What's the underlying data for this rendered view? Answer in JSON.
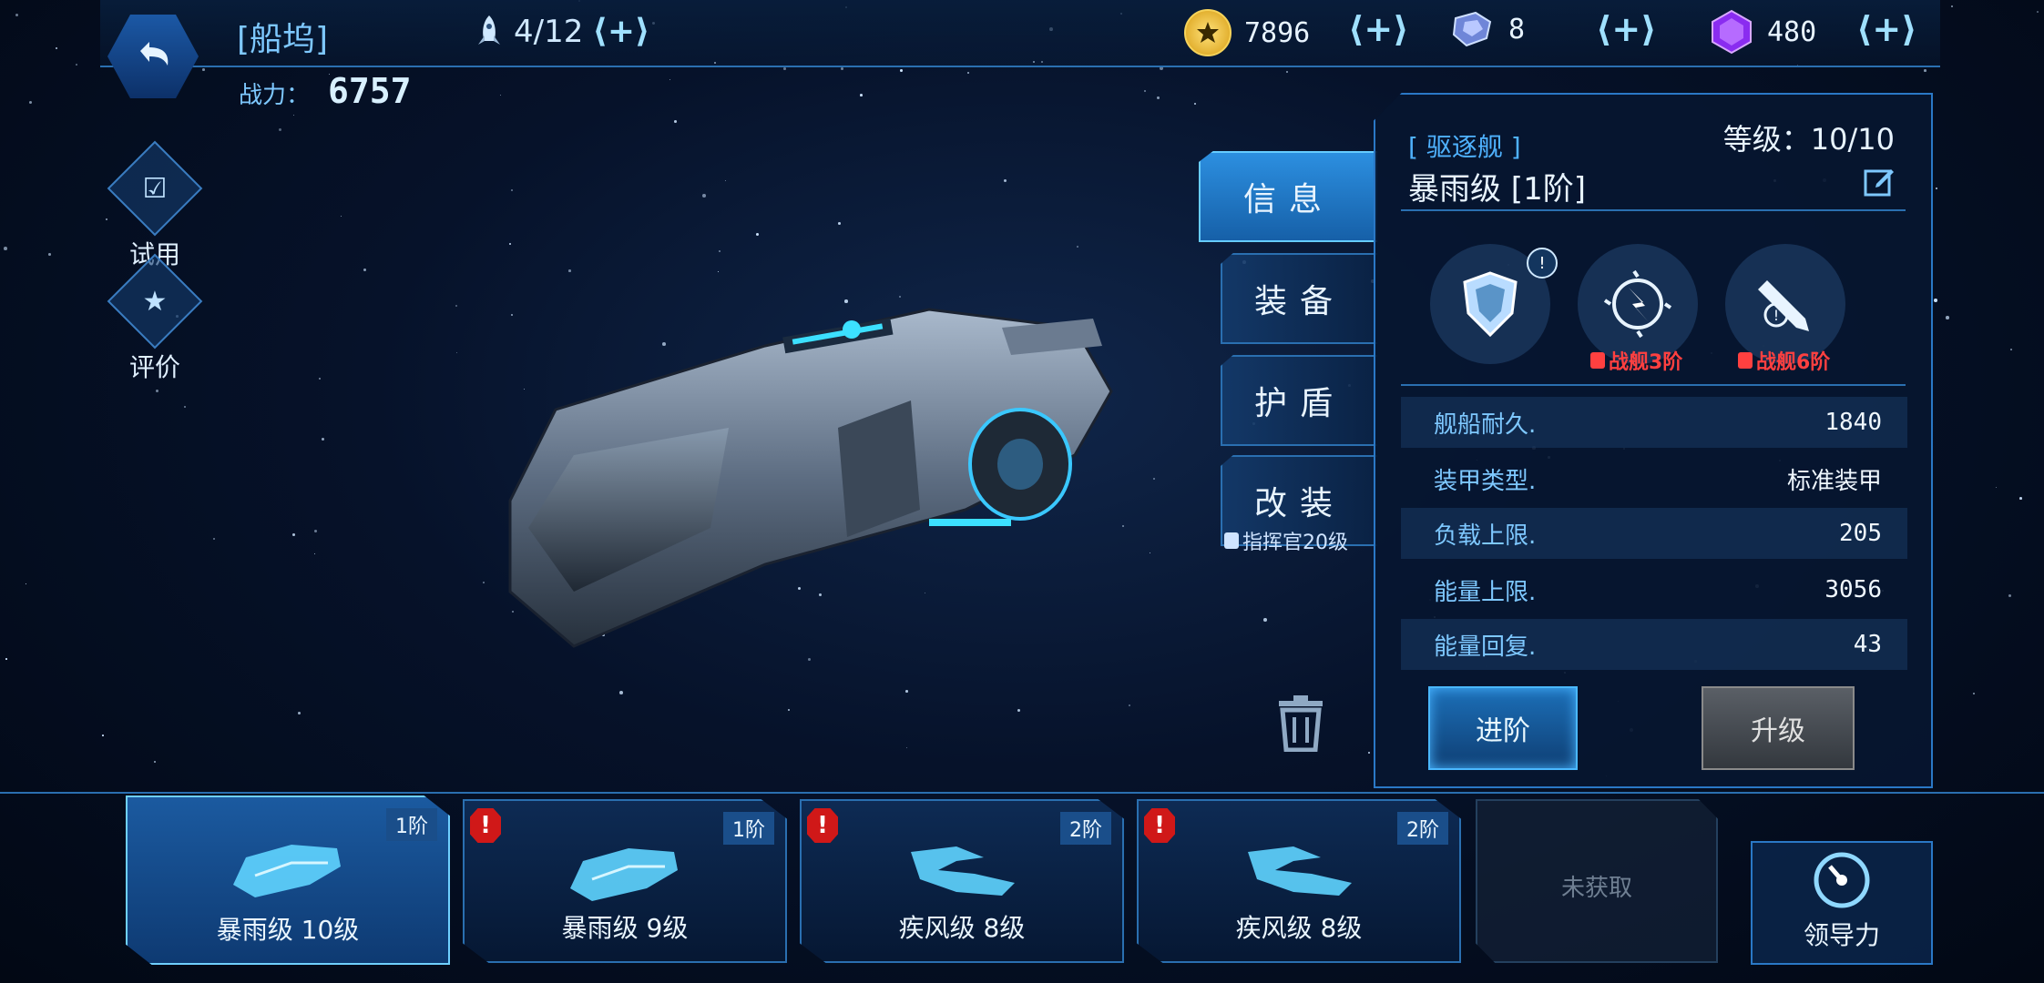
{
  "header": {
    "title": "[船坞]",
    "power_label": "战力：",
    "power_value": "6757",
    "fleet_count": "4/12",
    "fleet_plus": "⟨+⟩"
  },
  "resources": [
    {
      "name": "gold-coin",
      "value": "7896",
      "plus": "⟨+⟩",
      "color": "#f2c02c"
    },
    {
      "name": "crystal",
      "value": "8",
      "plus": "⟨+⟩",
      "color": "#8fa8ff"
    },
    {
      "name": "purple-gem",
      "value": "480",
      "plus": "⟨+⟩",
      "color": "#9c3cff"
    }
  ],
  "side": {
    "trial_label": "试用",
    "review_label": "评价"
  },
  "tabs": {
    "info": "信息",
    "equip": "装备",
    "shield": "护盾",
    "modify": "改装",
    "modify_lock": "指挥官20级"
  },
  "panel": {
    "ship_class": "[ 驱逐舰 ]",
    "level": "等级：10/10",
    "ship_name": "暴雨级 [1阶]",
    "skills": [
      {
        "icon": "armor-shield-icon",
        "lock": "",
        "badge": "!"
      },
      {
        "icon": "emp-burst-icon",
        "lock": "战舰3阶",
        "badge": ""
      },
      {
        "icon": "missile-icon",
        "lock": "战舰6阶",
        "badge": ""
      }
    ],
    "stats": [
      {
        "key": "舰船耐久.",
        "value": "1840"
      },
      {
        "key": "装甲类型.",
        "value": "标准装甲"
      },
      {
        "key": "负载上限.",
        "value": "205"
      },
      {
        "key": "能量上限.",
        "value": "3056"
      },
      {
        "key": "能量回复.",
        "value": "43"
      }
    ],
    "advance_button": "进阶",
    "upgrade_button": "升级"
  },
  "roster": [
    {
      "name": "暴雨级 10级",
      "tier": "1阶",
      "alert": false
    },
    {
      "name": "暴雨级 9级",
      "tier": "1阶",
      "alert": true
    },
    {
      "name": "疾风级 8级",
      "tier": "2阶",
      "alert": true
    },
    {
      "name": "疾风级 8级",
      "tier": "2阶",
      "alert": true
    },
    {
      "name": "未获取",
      "tier": "",
      "alert": false
    }
  ],
  "leadership_label": "领导力",
  "colors": {
    "accent": "#2a6fb0",
    "accent_light": "#4ab8ff",
    "lock_red": "#ff4040",
    "alert_red": "#d01818"
  }
}
